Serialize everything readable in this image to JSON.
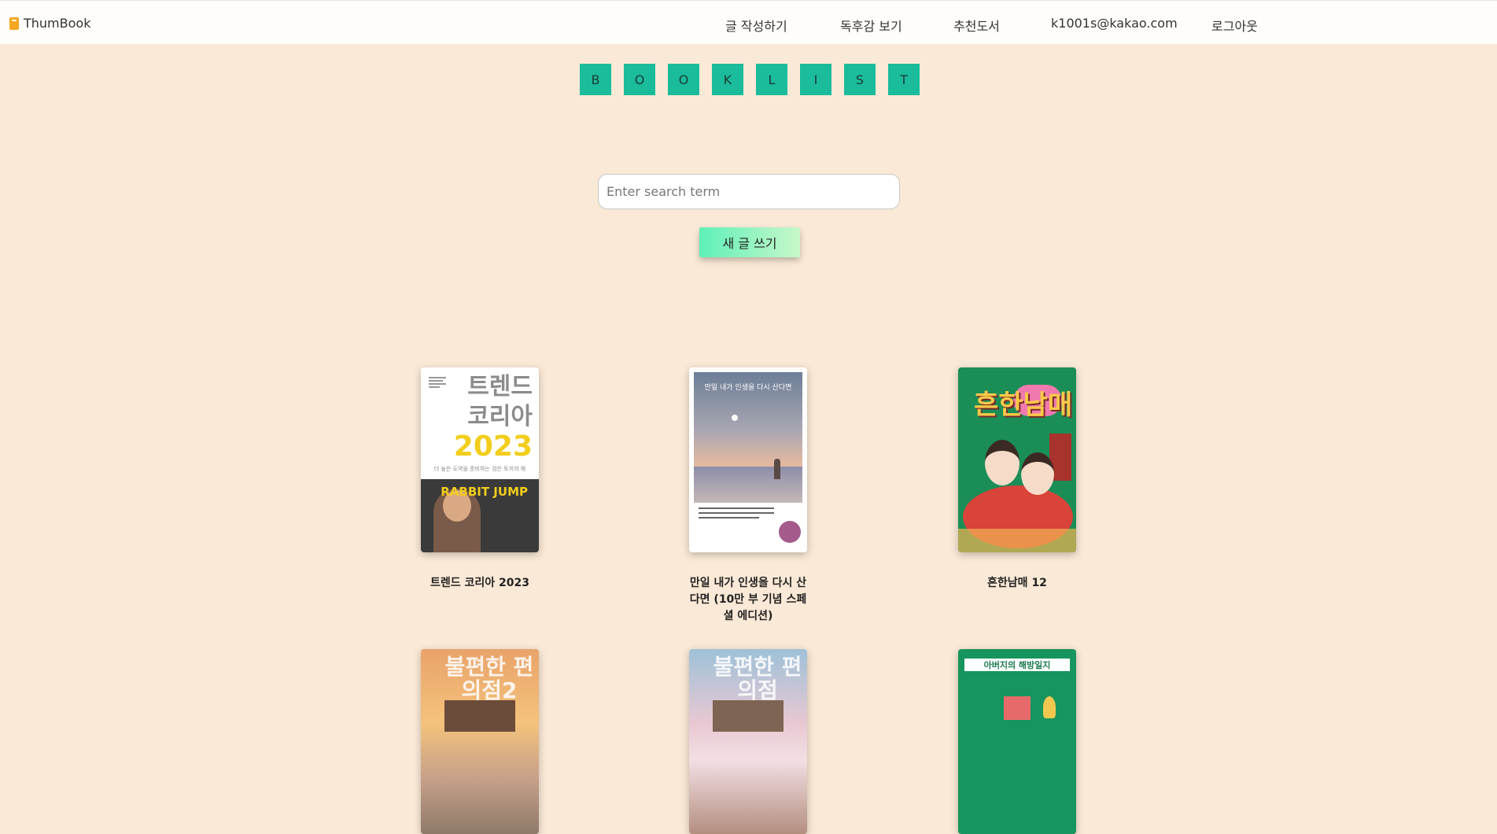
{
  "header": {
    "brand": "ThumBook",
    "nav": [
      {
        "label": "글 작성하기"
      },
      {
        "label": "독후감 보기"
      },
      {
        "label": "추천도서"
      },
      {
        "label": "k1001s@kakao.com"
      },
      {
        "label": "로그아웃"
      }
    ]
  },
  "banner_letters": [
    "B",
    "O",
    "O",
    "K",
    "L",
    "I",
    "S",
    "T"
  ],
  "search": {
    "placeholder": "Enter search term",
    "value": ""
  },
  "new_post_button": "새 글 쓰기",
  "books": [
    {
      "title": "트렌드 코리아 2023"
    },
    {
      "title": "만일 내가 인생을 다시 산다면 (10만 부 기념 스페셜 에디션)"
    },
    {
      "title": "흔한남매 12"
    },
    {
      "title": ""
    },
    {
      "title": ""
    },
    {
      "title": ""
    }
  ],
  "covers": {
    "trend": {
      "line1": "트렌드",
      "line2": "코리아",
      "year": "2023",
      "sub": "더 높은 도약을 준비하는 검은 토끼의 해",
      "band": "RABBIT JUMP"
    },
    "life": {
      "caption": "만일 내가 인생을 다시 산다면"
    },
    "sibling": {
      "title": "흔한남매"
    },
    "conv1": {
      "title": "불편한 편의점2"
    },
    "conv2": {
      "title": "불편한 편의점"
    },
    "father": {
      "title": "아버지의 해방일지"
    }
  },
  "colors": {
    "background": "#fae9d6",
    "header": "#fffdfa",
    "letter_tile": "#1abc9c",
    "button_gradient": [
      "#5ef0b8",
      "#c8f7c9"
    ]
  }
}
